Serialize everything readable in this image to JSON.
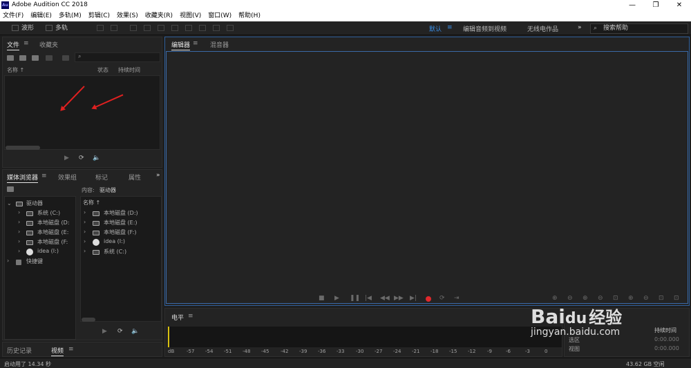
{
  "window": {
    "title": "Adobe Audition CC 2018",
    "logo": "Au"
  },
  "menu": [
    "文件(F)",
    "编辑(E)",
    "多轨(M)",
    "剪辑(C)",
    "效果(S)",
    "收藏夹(R)",
    "视图(V)",
    "窗口(W)",
    "帮助(H)"
  ],
  "toolbar": {
    "waveform_label": "波形",
    "multitrack_label": "多轨",
    "workspaces": [
      "默认",
      "编辑音频到视频",
      "无线电作品"
    ],
    "active_workspace": "默认",
    "more": "»",
    "search_placeholder": "搜索帮助"
  },
  "files_panel": {
    "tabs": [
      "文件",
      "收藏夹"
    ],
    "columns": [
      "名称",
      "状态",
      "持续时间"
    ]
  },
  "media_panel": {
    "tabs": [
      "媒体浏览器",
      "效果组",
      "标记",
      "属性"
    ],
    "content_label": "内容:",
    "content_value": "驱动器",
    "name_col": "名称",
    "tree": [
      {
        "label": "驱动器",
        "icon": "drive-icon"
      },
      {
        "label": "系统 (C:)",
        "icon": "system-drive-icon"
      },
      {
        "label": "本地磁盘 (D:",
        "icon": "drive-icon"
      },
      {
        "label": "本地磁盘 (E:",
        "icon": "drive-icon"
      },
      {
        "label": "本地磁盘 (F:",
        "icon": "drive-icon"
      },
      {
        "label": "idea (I:)",
        "icon": "disc-icon"
      },
      {
        "label": "快捷键",
        "icon": "shortcut-icon"
      }
    ],
    "list": [
      {
        "label": "本地磁盘 (D:)",
        "icon": "drive-icon"
      },
      {
        "label": "本地磁盘 (E:)",
        "icon": "drive-icon"
      },
      {
        "label": "本地磁盘 (F:)",
        "icon": "drive-icon"
      },
      {
        "label": "idea (I:)",
        "icon": "disc-icon"
      },
      {
        "label": "系统 (C:)",
        "icon": "system-drive-icon"
      }
    ]
  },
  "bottom_left": {
    "tabs": [
      "历史记录",
      "视频"
    ]
  },
  "editor": {
    "tabs": [
      "编辑器",
      "混音器"
    ]
  },
  "levels": {
    "title": "电平",
    "scale": [
      "dB",
      "-57",
      "-54",
      "-51",
      "-48",
      "-45",
      "-42",
      "-39",
      "-36",
      "-33",
      "-30",
      "-27",
      "-24",
      "-21",
      "-18",
      "-15",
      "-12",
      "-9",
      "-6",
      "-3",
      "0"
    ]
  },
  "selection": {
    "duration_label": "持续时间",
    "select_label": "选区",
    "view_label": "视图",
    "time_value": "0:00.000"
  },
  "status": {
    "left": "启动用了 14.34 秒",
    "right": "43.62 GB 空闲"
  },
  "watermark": {
    "brand": "Bai",
    "paw": "du",
    "cn": "经验",
    "url": "jingyan.baidu.com"
  },
  "colors": {
    "accent": "#3a8ee6",
    "record": "#e0282c",
    "annotation": "#e02020"
  }
}
